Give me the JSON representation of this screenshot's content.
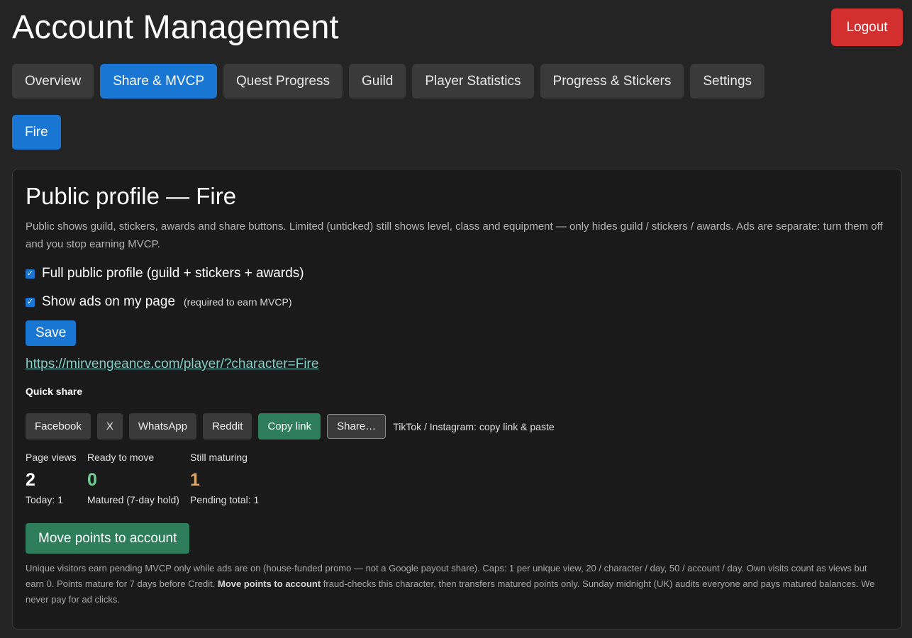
{
  "header": {
    "title": "Account Management",
    "logout_label": "Logout"
  },
  "tabs": [
    {
      "label": "Overview",
      "active": false
    },
    {
      "label": "Share & MVCP",
      "active": true
    },
    {
      "label": "Quest Progress",
      "active": false
    },
    {
      "label": "Guild",
      "active": false
    },
    {
      "label": "Player Statistics",
      "active": false
    },
    {
      "label": "Progress & Stickers",
      "active": false
    },
    {
      "label": "Settings",
      "active": false
    }
  ],
  "character_button": "Fire",
  "profile": {
    "title": "Public profile — Fire",
    "description": "Public shows guild, stickers, awards and share buttons. Limited (unticked) still shows level, class and equipment — only hides guild / stickers / awards. Ads are separate: turn them off and you stop earning MVCP.",
    "full_public": {
      "label": "Full public profile (guild + stickers + awards)",
      "checked": true
    },
    "show_ads": {
      "label": "Show ads on my page",
      "note": "(required to earn MVCP)",
      "checked": true
    },
    "save_label": "Save",
    "link": "https://mirvengeance.com/player/?character=Fire",
    "quick_share_heading": "Quick share",
    "share_buttons": {
      "facebook": "Facebook",
      "x": "X",
      "whatsapp": "WhatsApp",
      "reddit": "Reddit",
      "copy_link": "Copy link",
      "share": "Share…"
    },
    "share_hint": "TikTok / Instagram: copy link & paste",
    "stats": {
      "page_views": {
        "label": "Page views",
        "value": "2",
        "sub": "Today: 1",
        "color": "#ffffff"
      },
      "ready": {
        "label": "Ready to move",
        "value": "0",
        "sub": "Matured (7-day hold)",
        "color": "#6fcf97"
      },
      "maturing": {
        "label": "Still maturing",
        "value": "1",
        "sub": "Pending total: 1",
        "color": "#d9a86a"
      }
    },
    "move_label": "Move points to account",
    "footnote_part1": "Unique visitors earn pending MVCP only while ads are on (house-funded promo — not a Google payout share). Caps: 1 per unique view, 20 / character / day, 50 / account / day. Own visits count as views but earn 0. Points mature for 7 days before Credit.",
    "footnote_bold": "Move points to account",
    "footnote_part2": "fraud-checks this character, then transfers matured points only. Sunday midnight (UK) audits everyone and pays matured balances. We never pay for ad clicks."
  },
  "colors": {
    "accent": "#1976d2",
    "danger": "#d32f2f",
    "success": "#2e7d5b",
    "link": "#7fd0c8"
  }
}
